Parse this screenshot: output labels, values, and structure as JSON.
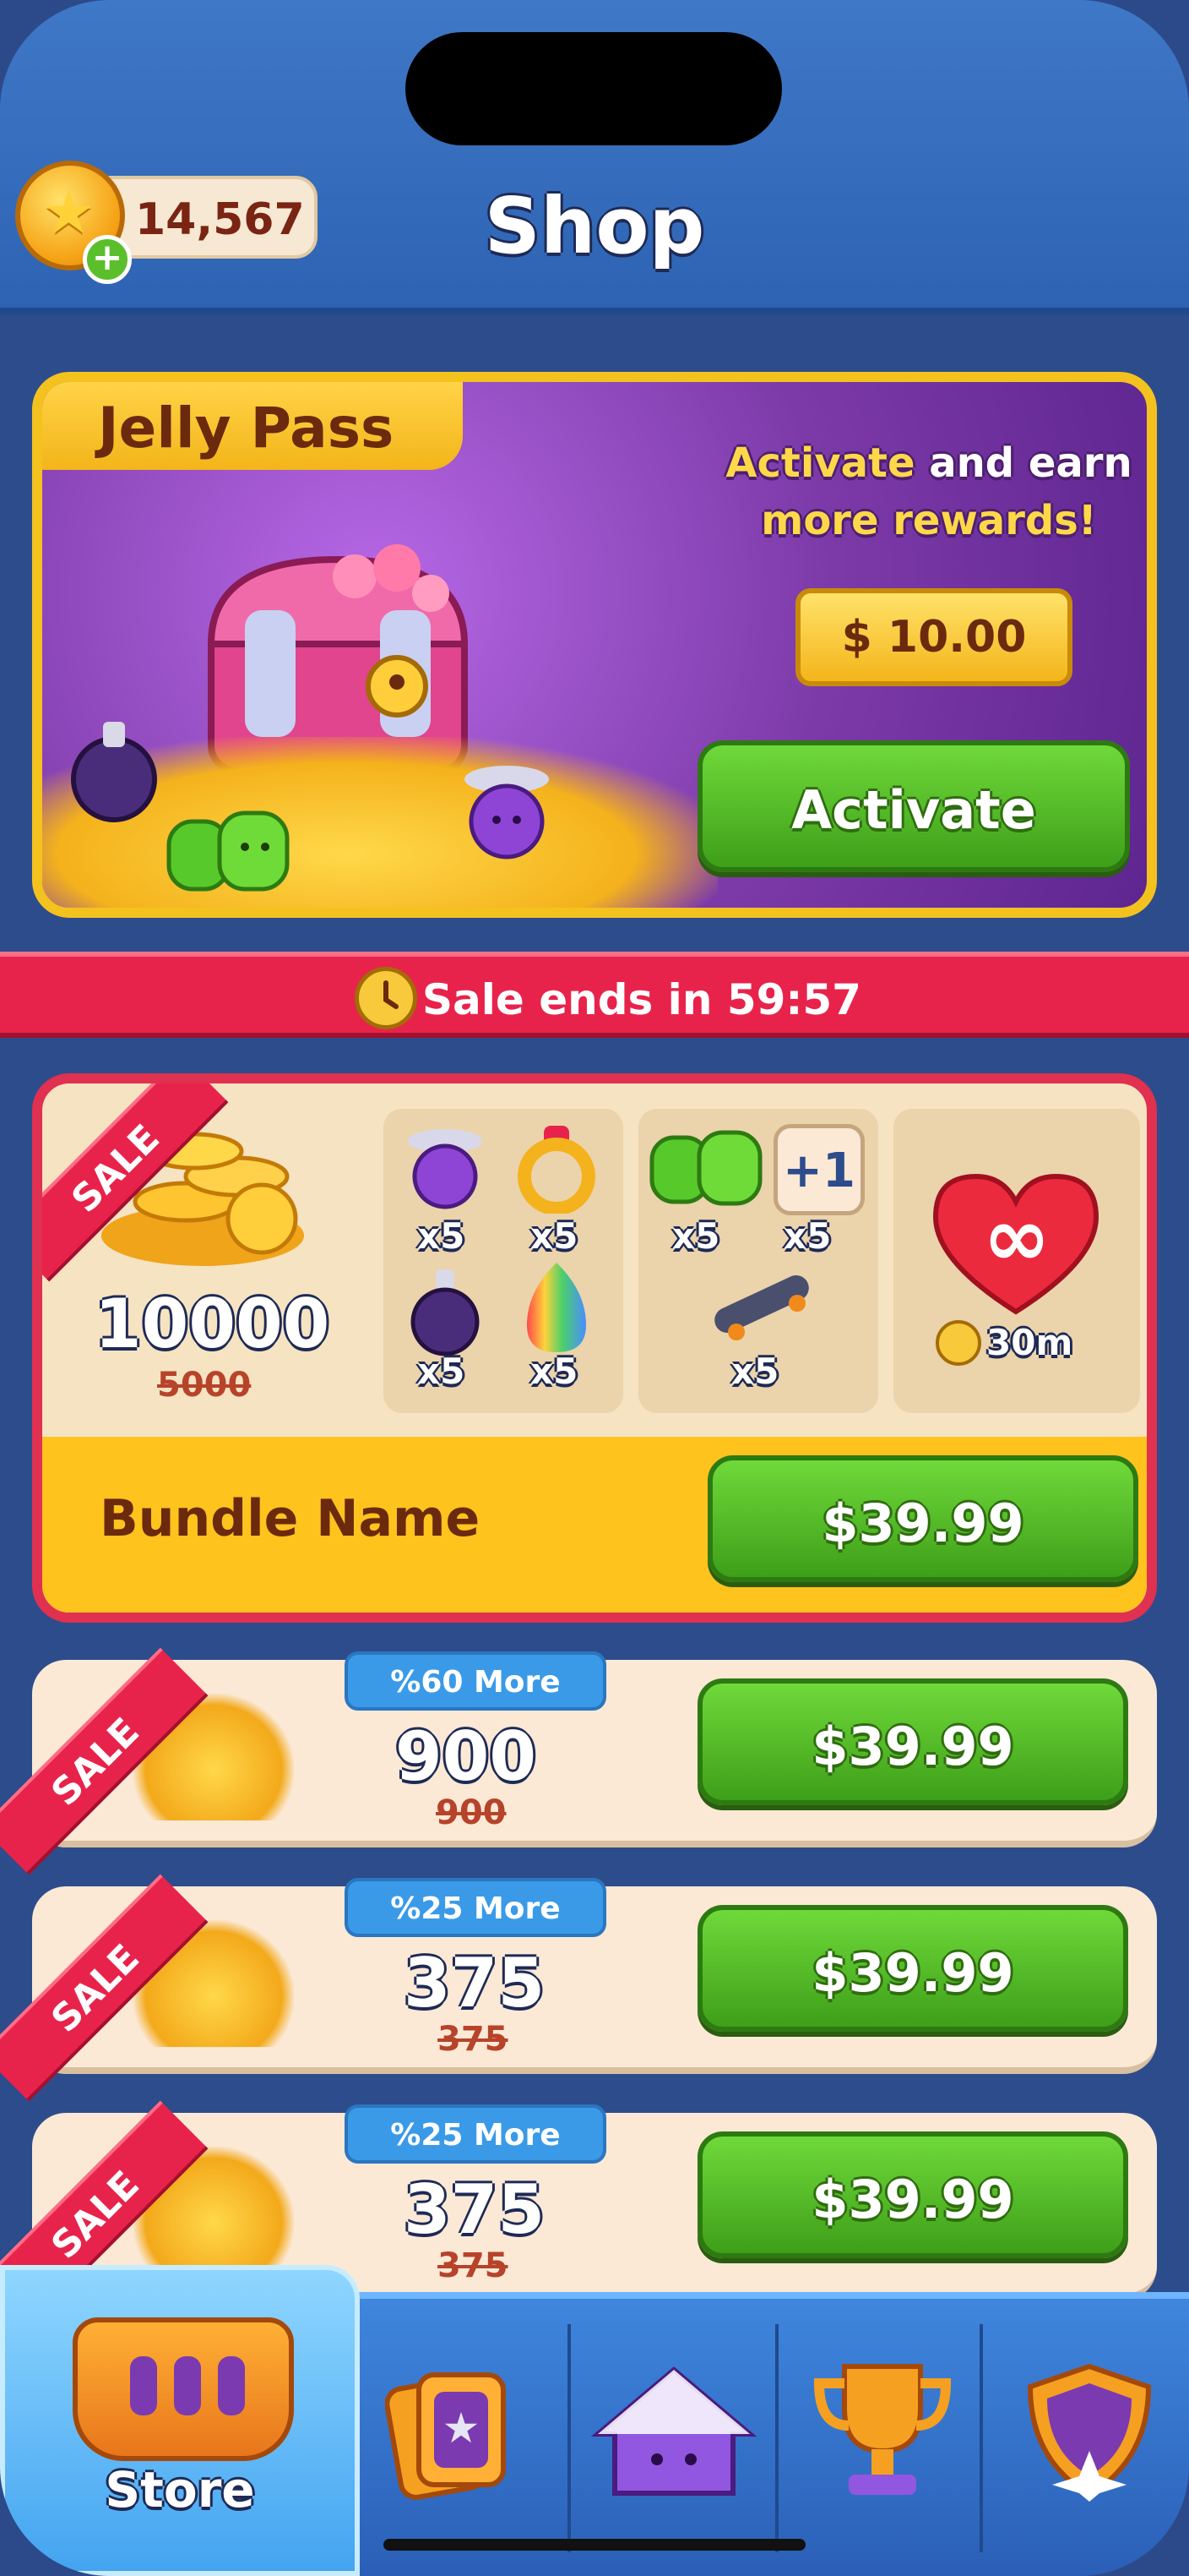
{
  "header": {
    "title": "Shop",
    "coins": "14,567",
    "add_coins": "+"
  },
  "jelly_pass": {
    "title": "Jelly Pass",
    "earn_highlight": "Activate",
    "earn_rest_1": " and earn",
    "earn_rest_2": "more rewards!",
    "price": "$ 10.00",
    "activate_label": "Activate"
  },
  "sale_banner": {
    "text": "Sale ends in 59:57"
  },
  "bundle": {
    "ribbon": "SALE",
    "coins": "10000",
    "coins_old": "5000",
    "items": [
      {
        "icon": "fan-jelly-icon",
        "qty": "x5"
      },
      {
        "icon": "ring-bomb-icon",
        "qty": "x5"
      },
      {
        "icon": "bomb-icon",
        "qty": "x5"
      },
      {
        "icon": "rainbow-flame-icon",
        "qty": "x5"
      },
      {
        "icon": "green-jelly-icon",
        "qty": "x5"
      },
      {
        "icon": "plus-one-icon",
        "qty": "x5",
        "label": "+1"
      },
      {
        "icon": "skateboard-icon",
        "qty": "x5"
      }
    ],
    "infinite_lives_symbol": "∞",
    "infinite_lives_time": "30m",
    "name": "Bundle Name",
    "price": "$39.99"
  },
  "offers": [
    {
      "ribbon": "SALE",
      "more": "%60 More",
      "coins": "900",
      "coins_old": "900",
      "price": "$39.99"
    },
    {
      "ribbon": "SALE",
      "more": "%25 More",
      "coins": "375",
      "coins_old": "375",
      "price": "$39.99"
    },
    {
      "ribbon": "SALE",
      "more": "%25 More",
      "coins": "375",
      "coins_old": "375",
      "price": "$39.99"
    }
  ],
  "nav": {
    "tabs": [
      {
        "label": "Store",
        "icon": "basket-icon",
        "active": true
      },
      {
        "label": "",
        "icon": "cards-icon"
      },
      {
        "label": "",
        "icon": "home-icon"
      },
      {
        "label": "",
        "icon": "trophy-icon"
      },
      {
        "label": "",
        "icon": "shield-icon"
      }
    ]
  },
  "colors": {
    "background": "#2d4c8c",
    "accent_green": "#4fba22",
    "sale_red": "#e8234b",
    "gold": "#f4c21f"
  }
}
